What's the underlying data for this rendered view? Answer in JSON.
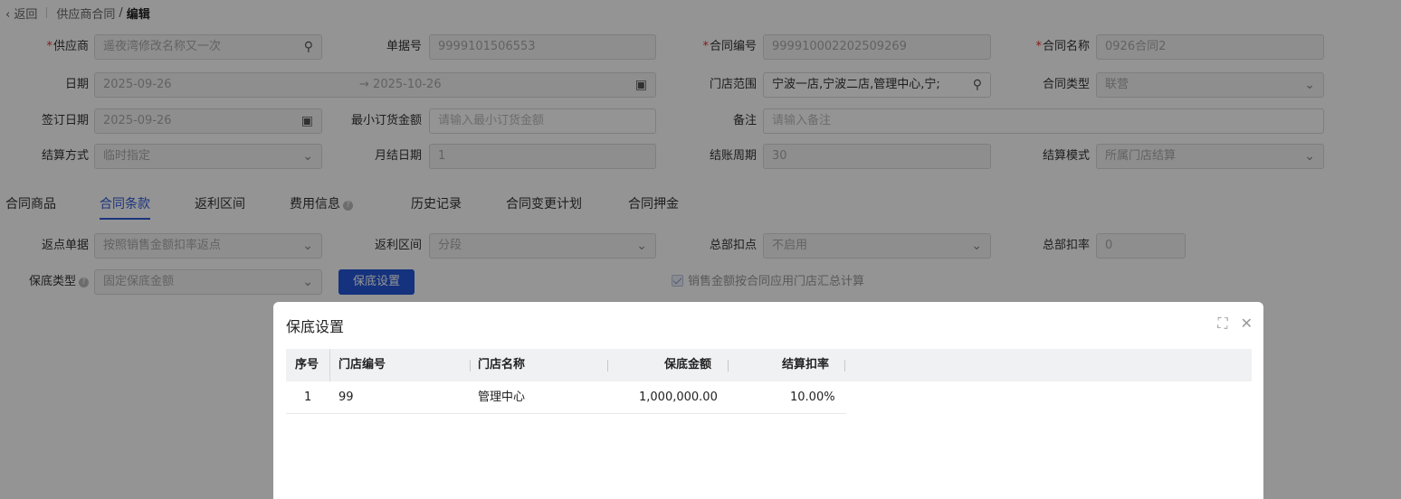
{
  "breadcrumb": {
    "back": "返回",
    "parent": "供应商合同",
    "separator": "/",
    "current": "编辑"
  },
  "form": {
    "supplier": {
      "label": "供应商",
      "value": "遥夜湾修改名称又一次"
    },
    "doc_no": {
      "label": "单据号",
      "value": "9999101506553"
    },
    "contract_no": {
      "label": "合同编号",
      "value": "999910002202509269"
    },
    "contract_name": {
      "label": "合同名称",
      "value": "0926合同2"
    },
    "date": {
      "label": "日期",
      "start": "2025-09-26",
      "arrow": "→",
      "end": "2025-10-26"
    },
    "store_scope": {
      "label": "门店范围",
      "value": "宁波一店,宁波二店,管理中心,宁;"
    },
    "contract_type": {
      "label": "合同类型",
      "value": "联营"
    },
    "sign_date": {
      "label": "签订日期",
      "value": "2025-09-26"
    },
    "min_order": {
      "label": "最小订货金额",
      "placeholder": "请输入最小订货金额"
    },
    "remark": {
      "label": "备注",
      "placeholder": "请输入备注"
    },
    "settle_method": {
      "label": "结算方式",
      "value": "临时指定"
    },
    "monthly_date": {
      "label": "月结日期",
      "value": "1"
    },
    "billing_cycle": {
      "label": "结账周期",
      "value": "30"
    },
    "settle_mode": {
      "label": "结算模式",
      "value": "所属门店结算"
    }
  },
  "tabs": [
    {
      "label": "合同商品",
      "active": false
    },
    {
      "label": "合同条款",
      "active": true
    },
    {
      "label": "返利区间",
      "active": false
    },
    {
      "label": "费用信息",
      "active": false
    },
    {
      "label": "历史记录",
      "active": false
    },
    {
      "label": "合同变更计划",
      "active": false
    },
    {
      "label": "合同押金",
      "active": false
    }
  ],
  "terms": {
    "rebate_doc": {
      "label": "返点单据",
      "value": "按照销售金额扣率返点"
    },
    "rebate_range": {
      "label": "返利区间",
      "value": "分段"
    },
    "hq_point": {
      "label": "总部扣点",
      "value": "不启用"
    },
    "hq_rate": {
      "label": "总部扣率",
      "value": "0"
    },
    "guarantee_type": {
      "label": "保底类型",
      "value": "固定保底金额"
    },
    "guarantee_button": "保底设置",
    "sales_checkbox": "销售金额按合同应用门店汇总计算"
  },
  "modal": {
    "title": "保底设置",
    "columns": [
      "序号",
      "门店编号",
      "门店名称",
      "保底金额",
      "结算扣率"
    ],
    "rows": [
      {
        "idx": "1",
        "store_no": "99",
        "store_name": "管理中心",
        "amount": "1,000,000.00",
        "rate": "10.00%"
      }
    ]
  },
  "icons": {
    "search": "search-icon",
    "calendar": "calendar-icon",
    "chevron": "chevron-down-icon",
    "help": "help-icon",
    "expand": "expand-icon",
    "close": "close-icon"
  }
}
